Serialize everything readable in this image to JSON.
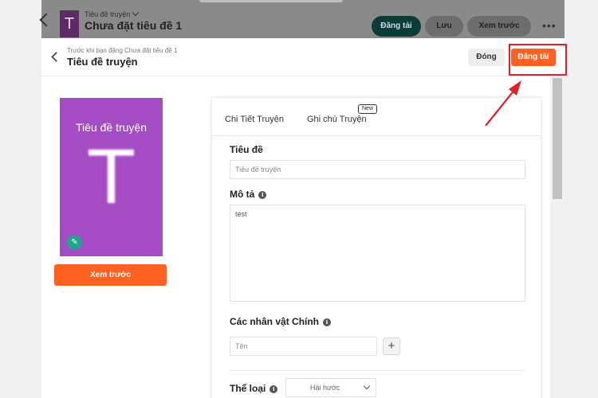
{
  "background_header": {
    "breadcrumb": "Tiêu đề truyện",
    "title": "Chưa đặt tiêu đề 1",
    "cover_letter": "T",
    "buttons": {
      "publish": "Đăng tải",
      "save": "Lưu",
      "preview": "Xem trước"
    },
    "more": "•••"
  },
  "modal": {
    "subtitle": "Trước khi bạn đăng Chưa đặt tiêu đề 1",
    "title": "Tiêu đề truyện",
    "close_label": "Đóng",
    "publish_label": "Đăng tải"
  },
  "cover": {
    "title": "Tiêu đề truyện",
    "letter": "T",
    "edit_icon": "pencil-icon",
    "preview_label": "Xem trước",
    "color": "#a54cc4"
  },
  "tabs": [
    {
      "label": "Chi Tiết Truyện"
    },
    {
      "label": "Ghi chú Truyện",
      "badge": "New"
    }
  ],
  "form": {
    "title_label": "Tiêu đề",
    "title_placeholder": "Tiêu đề truyện",
    "description_label": "Mô tả",
    "description_value": "test",
    "characters_label": "Các nhân vật Chính",
    "character_placeholder": "Tên",
    "add_button": "+",
    "genre_label": "Thể loại",
    "genre_selected": "Hài hước",
    "info_icon": "i"
  },
  "colors": {
    "accent": "#ff6122",
    "dark_button": "#0b3d36",
    "highlight": "#e0202a",
    "edit_badge": "#23a38f"
  }
}
